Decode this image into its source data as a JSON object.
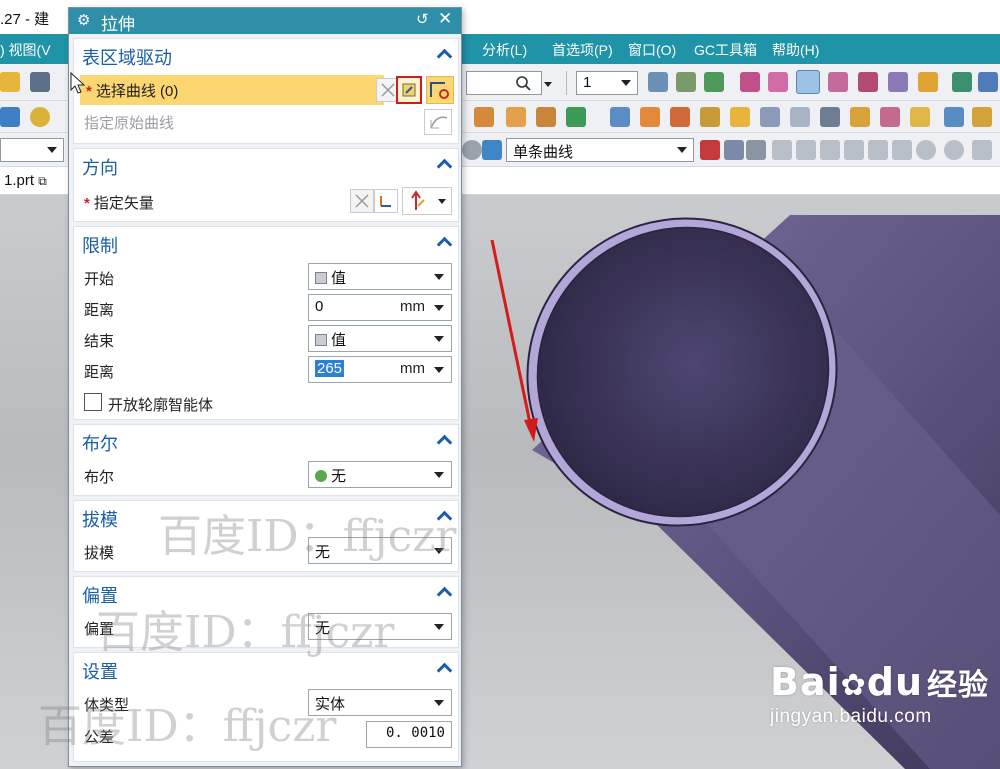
{
  "window": {
    "title": ".27 - 建"
  },
  "menu": {
    "left_item": ") 视图(V",
    "items": [
      "分析(L)",
      "首选项(P)",
      "窗口(O)",
      "GC工具箱",
      "帮助(H)"
    ]
  },
  "toolbar": {
    "search_placeholder": "",
    "layer_value": "1",
    "curve_rule": "单条曲线",
    "left_combo": ""
  },
  "tab": {
    "file_name": "1.prt"
  },
  "dialog": {
    "title": "拉伸",
    "section_drive": {
      "title": "表区域驱动",
      "select_curve": "选择曲线 (0)",
      "origin_curve": "指定原始曲线"
    },
    "section_direction": {
      "title": "方向",
      "vector": "指定矢量"
    },
    "section_limits": {
      "title": "限制",
      "start_label": "开始",
      "start_value": "值",
      "start_dist_label": "距离",
      "start_dist_value": "0",
      "end_label": "结束",
      "end_value": "值",
      "end_dist_label": "距离",
      "end_dist_value": "265",
      "unit": "mm",
      "open_profile": "开放轮廓智能体"
    },
    "section_boolean": {
      "title": "布尔",
      "label": "布尔",
      "value": "无"
    },
    "section_draft": {
      "title": "拔模",
      "label": "拔模",
      "value": "无"
    },
    "section_offset": {
      "title": "偏置",
      "label": "偏置",
      "value": "无"
    },
    "section_settings": {
      "title": "设置",
      "body_type_label": "体类型",
      "body_type_value": "实体",
      "tolerance_label": "公差",
      "tolerance_value": "0. 0010"
    }
  },
  "watermarks": {
    "id_text": "百度ID：ffjczr",
    "baidu_logo": "Bai",
    "baidu_du": "du",
    "baidu_cn": "经验",
    "baidu_url": "jingyan.baidu.com"
  },
  "colors": {
    "menu_bar": "#1f93a8",
    "dialog_title": "#2f8ea8",
    "section_title": "#1a5ea8",
    "highlight_row": "#fbd671",
    "tube": "#6e6391",
    "annotation": "#d51a1a"
  }
}
